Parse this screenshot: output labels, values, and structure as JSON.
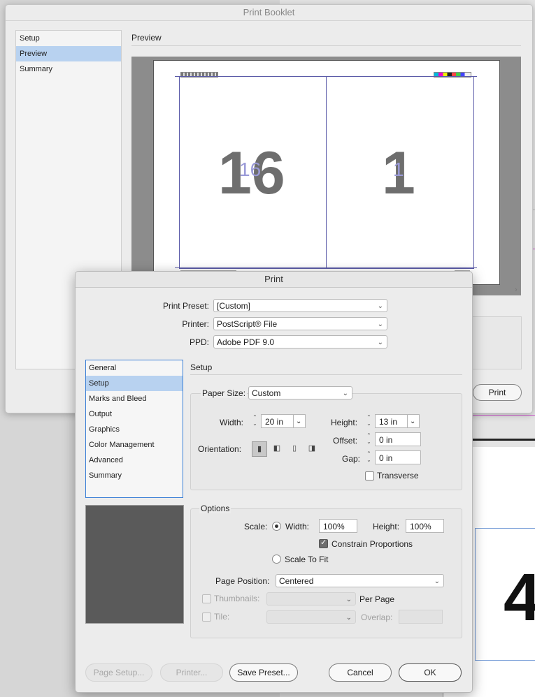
{
  "booklet": {
    "title": "Print Booklet",
    "nav": [
      "Setup",
      "Preview",
      "Summary"
    ],
    "nav_selected": 1,
    "section_title": "Preview",
    "left_page_number": "16",
    "right_page_number": "1",
    "left_ghost": "16",
    "right_ghost": "1",
    "print_button": "Print"
  },
  "print": {
    "title": "Print",
    "preset_label": "Print Preset:",
    "preset_value": "[Custom]",
    "printer_label": "Printer:",
    "printer_value": "PostScript® File",
    "ppd_label": "PPD:",
    "ppd_value": "Adobe PDF 9.0",
    "nav": [
      "General",
      "Setup",
      "Marks and Bleed",
      "Output",
      "Graphics",
      "Color Management",
      "Advanced",
      "Summary"
    ],
    "nav_selected": 1,
    "section_title": "Setup",
    "paper_size_label": "Paper Size:",
    "paper_size_value": "Custom",
    "width_label": "Width:",
    "width_value": "20 in",
    "height_label": "Height:",
    "height_value": "13 in",
    "offset_label": "Offset:",
    "offset_value": "0 in",
    "gap_label": "Gap:",
    "gap_value": "0 in",
    "orientation_label": "Orientation:",
    "transverse_label": "Transverse",
    "transverse_checked": false,
    "options_title": "Options",
    "scale_label": "Scale:",
    "scale_width_label": "Width:",
    "scale_width_value": "100%",
    "scale_height_label": "Height:",
    "scale_height_value": "100%",
    "constrain_label": "Constrain Proportions",
    "constrain_checked": true,
    "scale_to_fit_label": "Scale To Fit",
    "page_position_label": "Page Position:",
    "page_position_value": "Centered",
    "thumbnails_label": "Thumbnails:",
    "per_page_label": "Per Page",
    "tile_label": "Tile:",
    "overlap_label": "Overlap:",
    "buttons": {
      "page_setup": "Page Setup...",
      "printer": "Printer...",
      "save_preset": "Save Preset...",
      "cancel": "Cancel",
      "ok": "OK"
    }
  },
  "background": {
    "big_number": "4"
  }
}
